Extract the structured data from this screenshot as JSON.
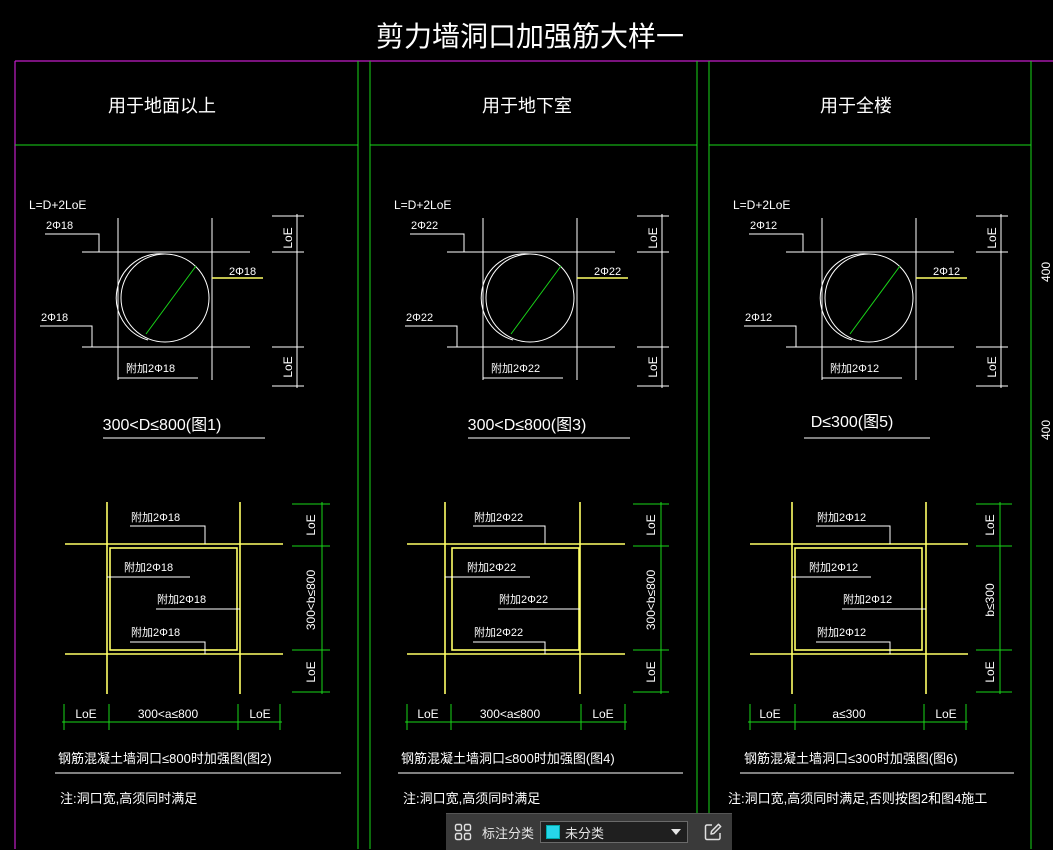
{
  "drawing": {
    "title": "剪力墙洞口加强筋大样一",
    "columns": [
      {
        "header": "用于地面以上",
        "formula": "L=D+2LoE",
        "bar_top": "2Φ18",
        "bar_right": "2Φ18",
        "bar_left": "2Φ18",
        "extra_bar": "附加2Φ18",
        "dim_top": "LoE",
        "dim_bottom": "LoE",
        "caption_round": "300<D≤800(图1)",
        "rect_bar_top": "附加2Φ18",
        "rect_bar_left": "附加2Φ18",
        "rect_bar_mid": "附加2Φ18",
        "rect_bar_bot": "附加2Φ18",
        "rect_dim_top": "LoE",
        "rect_dim_mid": "300<b≤800",
        "rect_dim_bot": "LoE",
        "width_left": "LoE",
        "width_mid": "300<a≤800",
        "width_right": "LoE",
        "caption_rect": "钢筋混凝土墙洞口≤800时加强图(图2)",
        "note": "注:洞口宽,高须同时满足"
      },
      {
        "header": "用于地下室",
        "formula": "L=D+2LoE",
        "bar_top": "2Φ22",
        "bar_right": "2Φ22",
        "bar_left": "2Φ22",
        "extra_bar": "附加2Φ22",
        "dim_top": "LoE",
        "dim_bottom": "LoE",
        "caption_round": "300<D≤800(图3)",
        "rect_bar_top": "附加2Φ22",
        "rect_bar_left": "附加2Φ22",
        "rect_bar_mid": "附加2Φ22",
        "rect_bar_bot": "附加2Φ22",
        "rect_dim_top": "LoE",
        "rect_dim_mid": "300<b≤800",
        "rect_dim_bot": "LoE",
        "width_left": "LoE",
        "width_mid": "300<a≤800",
        "width_right": "LoE",
        "caption_rect": "钢筋混凝土墙洞口≤800时加强图(图4)",
        "note": "注:洞口宽,高须同时满足"
      },
      {
        "header": "用于全楼",
        "formula": "L=D+2LoE",
        "bar_top": "2Φ12",
        "bar_right": "2Φ12",
        "bar_left": "2Φ12",
        "extra_bar": "附加2Φ12",
        "dim_top": "LoE",
        "dim_bottom": "LoE",
        "caption_round": "D≤300(图5)",
        "rect_bar_top": "附加2Φ12",
        "rect_bar_left": "附加2Φ12",
        "rect_bar_mid": "附加2Φ12",
        "rect_bar_bot": "附加2Φ12",
        "rect_dim_top": "LoE",
        "rect_dim_mid": "b≤300",
        "rect_dim_bot": "LoE",
        "width_left": "LoE",
        "width_mid": "a≤300",
        "width_right": "LoE",
        "caption_rect": "钢筋混凝土墙洞口≤300时加强图(图6)",
        "note": "注:洞口宽,高须同时满足,否则按图2和图4施工"
      }
    ],
    "edge_dim_top": "400",
    "edge_dim_bottom": "400"
  },
  "toolbar": {
    "grid_icon": "grid-icon",
    "label": "标注分类",
    "select_value": "未分类",
    "swatch_color": "#26d5e8",
    "edit_icon": "edit-icon"
  }
}
